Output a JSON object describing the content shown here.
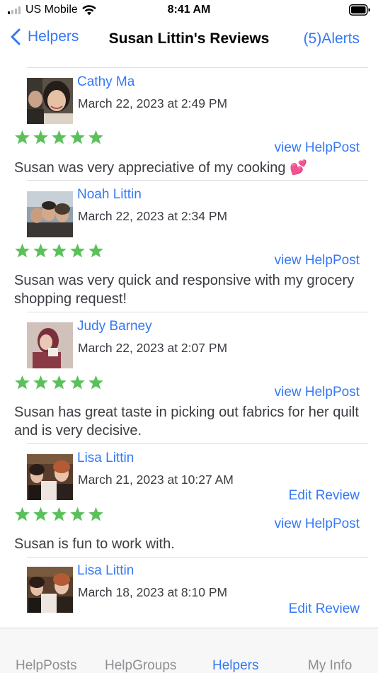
{
  "status_bar": {
    "carrier": "US Mobile",
    "time": "8:41 AM",
    "signal_bars_on": 1,
    "signal_bars_total": 4
  },
  "nav": {
    "back_label": "Helpers",
    "title": "Susan Littin's Reviews",
    "alerts_label": "(5)Alerts"
  },
  "colors": {
    "accent": "#3478f6",
    "star": "#5ac15a",
    "tab_inactive": "#8e8e93"
  },
  "reviews": [
    {
      "name": "Cathy Ma",
      "date": "March 22, 2023 at 2:49 PM",
      "rating": 5,
      "view_link": "view HelpPost",
      "text": "Susan was very appreciative of my cooking 💕"
    },
    {
      "name": "Noah Littin",
      "date": "March 22, 2023 at 2:34 PM",
      "rating": 5,
      "view_link": "view HelpPost",
      "text": "Susan was very quick and responsive with my grocery shopping request!"
    },
    {
      "name": "Judy Barney",
      "date": "March 22, 2023 at 2:07 PM",
      "rating": 5,
      "view_link": "view HelpPost",
      "text": "Susan has great taste in picking out fabrics for her quilt and is very decisive."
    },
    {
      "name": "Lisa Littin",
      "date": "March 21, 2023 at 10:27 AM",
      "rating": 5,
      "edit_link": "Edit Review",
      "view_link": "view HelpPost",
      "text": "Susan is fun to work with."
    },
    {
      "name": "Lisa Littin",
      "date": "March 18, 2023 at 8:10 PM",
      "edit_link": "Edit Review"
    }
  ],
  "tabs": [
    {
      "label": "HelpPosts",
      "active": false
    },
    {
      "label": "HelpGroups",
      "active": false
    },
    {
      "label": "Helpers",
      "active": true
    },
    {
      "label": "My Info",
      "active": false
    }
  ]
}
